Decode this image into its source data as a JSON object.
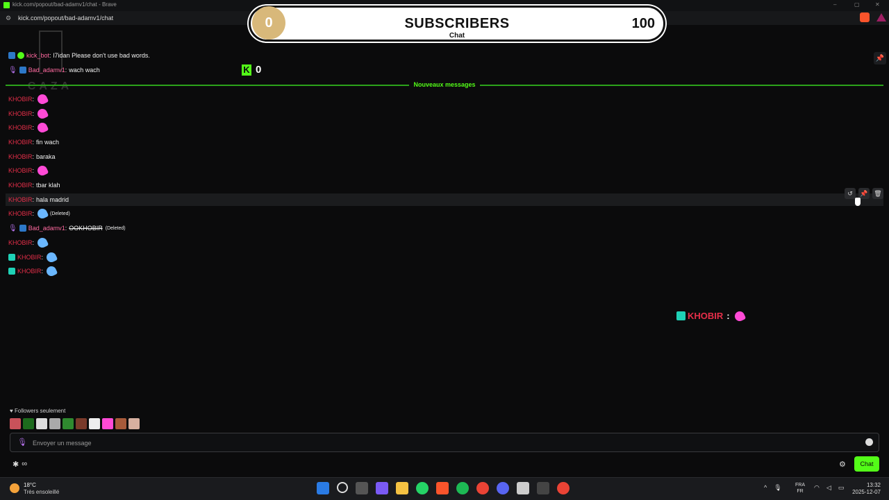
{
  "browser": {
    "window_title": "kick.com/popout/bad-adamv1/chat - Brave",
    "url": "kick.com/popout/bad-adamv1/chat"
  },
  "subscribers_overlay": {
    "current": "0",
    "label": "SUBSCRIBERS",
    "goal": "100",
    "sublabel": "Chat"
  },
  "kick_counter": {
    "value": "0"
  },
  "watermark": {
    "text": "CAZA"
  },
  "pinned_messages": [
    {
      "user": "kick_bot",
      "text": "l7idan Please don't use bad words."
    },
    {
      "user": "Bad_adamv1",
      "text": "wach wach"
    }
  ],
  "new_messages_label": "Nouveaux messages",
  "messages": [
    {
      "user": "KHOBIR",
      "text": "",
      "emote": "pink"
    },
    {
      "user": "KHOBIR",
      "text": "",
      "emote": "pink"
    },
    {
      "user": "KHOBIR",
      "text": "",
      "emote": "pink"
    },
    {
      "user": "KHOBIR",
      "text": "fin wach"
    },
    {
      "user": "KHOBIR",
      "text": "baraka"
    },
    {
      "user": "KHOBIR",
      "text": "",
      "emote": "pink"
    },
    {
      "user": "KHOBIR",
      "text": "tbar klah"
    },
    {
      "user": "KHOBIR",
      "text": "hala madrid"
    },
    {
      "user": "KHOBIR",
      "text": "",
      "emote": "blue",
      "deleted": "(Deleted)"
    },
    {
      "user": "Bad_adamv1",
      "text": "OOKHOBIR",
      "deleted": "(Deleted)"
    },
    {
      "user": "KHOBIR",
      "text": "",
      "emote": "blue"
    },
    {
      "user": "KHOBIR",
      "text": "",
      "emote": "blue"
    },
    {
      "user": "KHOBIR",
      "text": "",
      "emote": "blue"
    }
  ],
  "overlay_message": {
    "user": "KHOBIR",
    "sep": ":"
  },
  "followers_only": "Followers seulement",
  "input": {
    "placeholder": "Envoyer un message"
  },
  "chat_button": "Chat",
  "taskbar": {
    "temp": "18°C",
    "condition": "Très ensoleillé",
    "lang_top": "FRA",
    "lang_bottom": "FR",
    "time": "13:32",
    "date": "2025-12-07"
  },
  "colors": {
    "accent": "#53fc18",
    "username": "#e62e49",
    "background": "#0b0b0c"
  }
}
